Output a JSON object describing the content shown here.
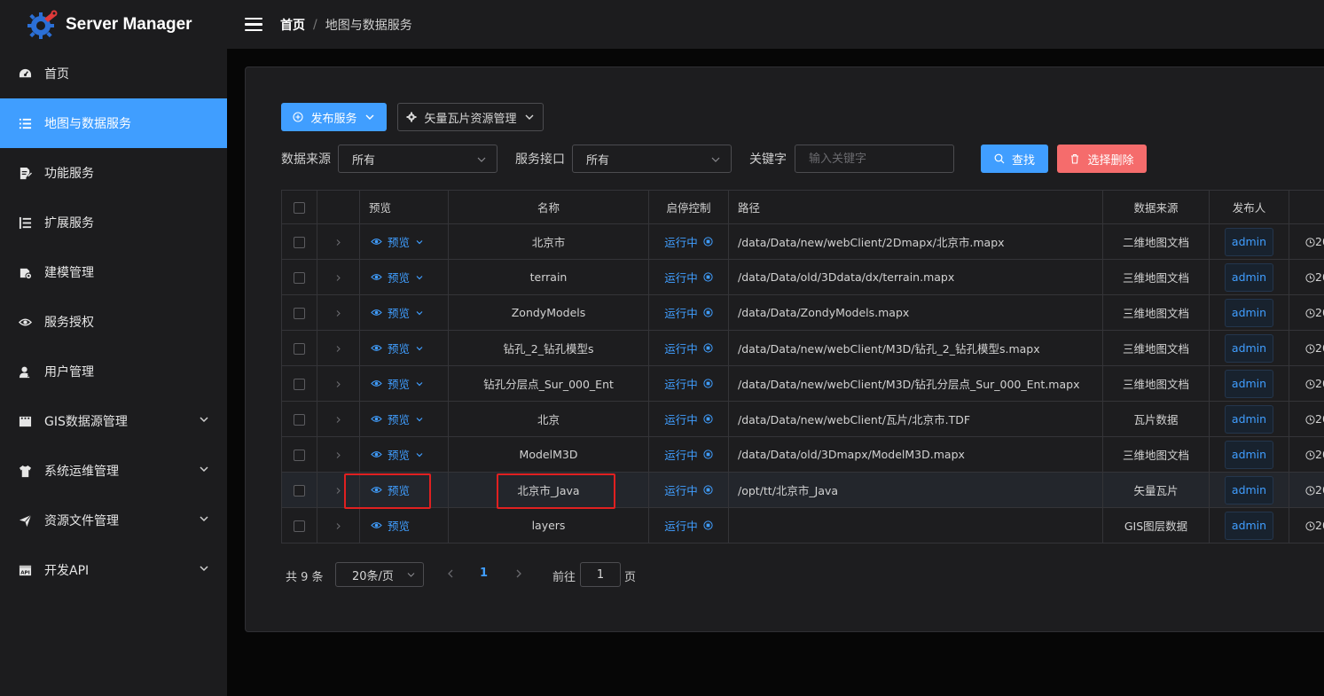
{
  "app": {
    "title": "Server Manager",
    "accent_color": "#409eff",
    "danger_color": "#f56c6c"
  },
  "breadcrumb": {
    "home": "首页",
    "current": "地图与数据服务"
  },
  "sidebar": {
    "items": [
      {
        "label": "首页",
        "icon": "dashboard-icon",
        "active": false
      },
      {
        "label": "地图与数据服务",
        "icon": "list-icon",
        "active": true
      },
      {
        "label": "功能服务",
        "icon": "document-edit-icon",
        "active": false
      },
      {
        "label": "扩展服务",
        "icon": "list-ordered-icon",
        "active": false
      },
      {
        "label": "建模管理",
        "icon": "settings-gear-icon",
        "active": false
      },
      {
        "label": "服务授权",
        "icon": "eye-icon",
        "active": false
      },
      {
        "label": "用户管理",
        "icon": "user-icon",
        "active": false
      },
      {
        "label": "GIS数据源管理",
        "icon": "film-icon",
        "active": false,
        "expandable": true
      },
      {
        "label": "系统运维管理",
        "icon": "shirt-icon",
        "active": false,
        "expandable": true
      },
      {
        "label": "资源文件管理",
        "icon": "send-icon",
        "active": false,
        "expandable": true
      },
      {
        "label": "开发API",
        "icon": "api-icon",
        "active": false,
        "expandable": true
      }
    ]
  },
  "toolbar": {
    "publish_label": "发布服务",
    "vector_tile_label": "矢量瓦片资源管理",
    "search_label": "查找",
    "delete_label": "选择删除"
  },
  "filters": {
    "source_label": "数据来源",
    "source_value": "所有",
    "interface_label": "服务接口",
    "interface_value": "所有",
    "keyword_label": "关键字",
    "keyword_placeholder": "输入关键字",
    "keyword_value": ""
  },
  "table": {
    "columns": {
      "preview": "预览",
      "name": "名称",
      "control": "启停控制",
      "path": "路径",
      "source": "数据来源",
      "publisher": "发布人"
    },
    "rows": [
      {
        "preview": "预览",
        "has_dropdown": true,
        "name": "北京市",
        "status": "运行中",
        "path": "/data/Data/new/webClient/2Dmapx/北京市.mapx",
        "source": "二维地图文档",
        "publisher": "admin",
        "time": "20"
      },
      {
        "preview": "预览",
        "has_dropdown": true,
        "name": "terrain",
        "status": "运行中",
        "path": "/data/Data/old/3Ddata/dx/terrain.mapx",
        "source": "三维地图文档",
        "publisher": "admin",
        "time": "20"
      },
      {
        "preview": "预览",
        "has_dropdown": true,
        "name": "ZondyModels",
        "status": "运行中",
        "path": "/data/Data/ZondyModels.mapx",
        "source": "三维地图文档",
        "publisher": "admin",
        "time": "20"
      },
      {
        "preview": "预览",
        "has_dropdown": true,
        "name": "钻孔_2_钻孔模型s",
        "status": "运行中",
        "path": "/data/Data/new/webClient/M3D/钻孔_2_钻孔模型s.mapx",
        "source": "三维地图文档",
        "publisher": "admin",
        "time": "20"
      },
      {
        "preview": "预览",
        "has_dropdown": true,
        "name": "钻孔分层点_Sur_000_Ent",
        "status": "运行中",
        "path": "/data/Data/new/webClient/M3D/钻孔分层点_Sur_000_Ent.mapx",
        "source": "三维地图文档",
        "publisher": "admin",
        "time": "20"
      },
      {
        "preview": "预览",
        "has_dropdown": true,
        "name": "北京",
        "status": "运行中",
        "path": "/data/Data/new/webClient/瓦片/北京市.TDF",
        "source": "瓦片数据",
        "publisher": "admin",
        "time": "20"
      },
      {
        "preview": "预览",
        "has_dropdown": true,
        "name": "ModelM3D",
        "status": "运行中",
        "path": "/data/Data/old/3Dmapx/ModelM3D.mapx",
        "source": "三维地图文档",
        "publisher": "admin",
        "time": "20"
      },
      {
        "preview": "预览",
        "has_dropdown": false,
        "name": "北京市_Java",
        "status": "运行中",
        "path": "/opt/tt/北京市_Java",
        "source": "矢量瓦片",
        "publisher": "admin",
        "time": "20",
        "highlighted": true
      },
      {
        "preview": "预览",
        "has_dropdown": false,
        "name": "layers",
        "status": "运行中",
        "path": "",
        "source": "GIS图层数据",
        "publisher": "admin",
        "time": "20"
      }
    ]
  },
  "pagination": {
    "total_text": "共 9 条",
    "page_size": "20条/页",
    "current_page": "1",
    "goto_label": "前往",
    "goto_value": "1",
    "page_suffix": "页"
  }
}
